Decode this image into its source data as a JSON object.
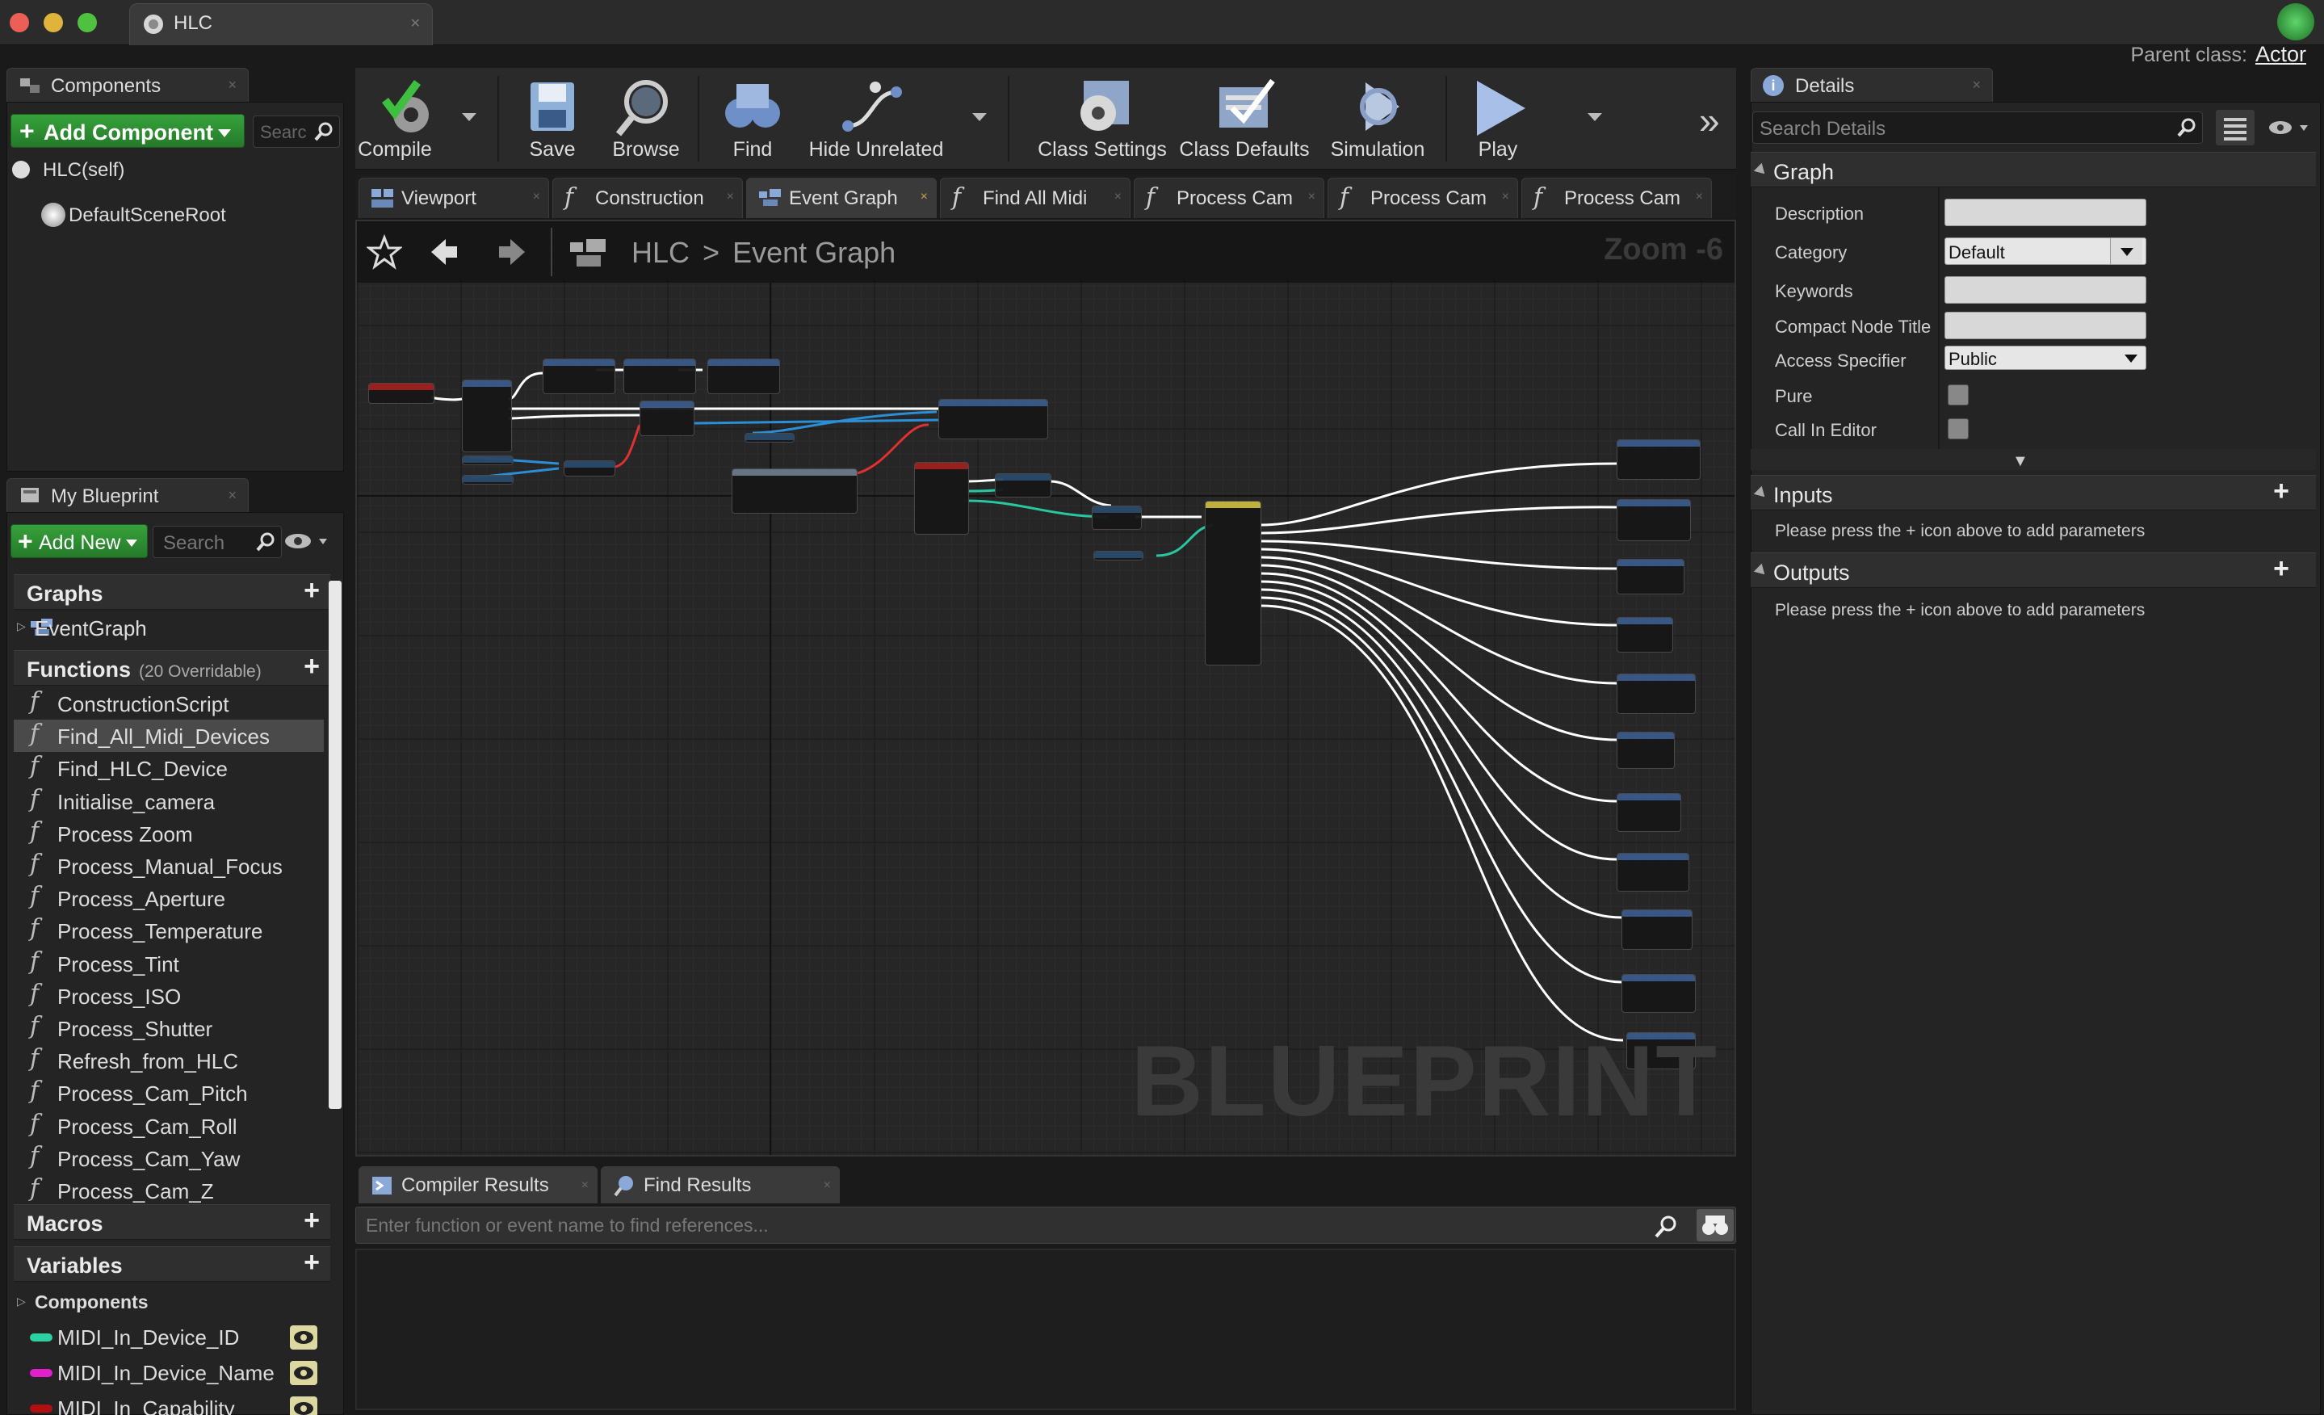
{
  "window": {
    "tab_title": "HLC",
    "parent_class_label": "Parent class:",
    "parent_class_value": "Actor"
  },
  "components_panel": {
    "tab_label": "Components",
    "add_component_label": "Add Component",
    "search_placeholder": "Searc",
    "tree": [
      {
        "label": "HLC(self)"
      },
      {
        "label": "DefaultSceneRoot"
      }
    ]
  },
  "toolbar": {
    "buttons": [
      {
        "label": "Compile",
        "icon": "compile-icon"
      },
      {
        "label": "Save",
        "icon": "save-icon"
      },
      {
        "label": "Browse",
        "icon": "browse-icon"
      },
      {
        "label": "Find",
        "icon": "find-icon"
      },
      {
        "label": "Hide Unrelated",
        "icon": "hide-unrelated-icon"
      },
      {
        "label": "Class Settings",
        "icon": "class-settings-icon"
      },
      {
        "label": "Class Defaults",
        "icon": "class-defaults-icon"
      },
      {
        "label": "Simulation",
        "icon": "simulation-icon"
      },
      {
        "label": "Play",
        "icon": "play-icon"
      }
    ]
  },
  "doc_tabs": [
    {
      "label": "Viewport",
      "icon": "viewport-icon"
    },
    {
      "label": "Construction",
      "icon": "function-icon"
    },
    {
      "label": "Event Graph",
      "icon": "event-graph-icon",
      "active": true
    },
    {
      "label": "Find All Midi",
      "icon": "function-icon"
    },
    {
      "label": "Process Cam",
      "icon": "function-icon"
    },
    {
      "label": "Process Cam",
      "icon": "function-icon"
    },
    {
      "label": "Process Cam",
      "icon": "function-icon"
    }
  ],
  "graph": {
    "breadcrumb_root": "HLC",
    "breadcrumb_sep": ">",
    "breadcrumb_current": "Event Graph",
    "zoom": "Zoom -6",
    "watermark": "BLUEPRINT"
  },
  "results": {
    "tabs": [
      {
        "label": "Compiler Results"
      },
      {
        "label": "Find Results"
      }
    ],
    "find_placeholder": "Enter function or event name to find references..."
  },
  "my_blueprint": {
    "tab_label": "My Blueprint",
    "add_new_label": "Add New",
    "search_placeholder": "Search",
    "graphs_label": "Graphs",
    "graphs": [
      {
        "label": "EventGraph"
      }
    ],
    "functions_label": "Functions",
    "functions_sub": "(20 Overridable)",
    "functions": [
      {
        "label": "ConstructionScript"
      },
      {
        "label": "Find_All_Midi_Devices",
        "selected": true
      },
      {
        "label": "Find_HLC_Device"
      },
      {
        "label": "Initialise_camera"
      },
      {
        "label": "Process Zoom"
      },
      {
        "label": "Process_Manual_Focus"
      },
      {
        "label": "Process_Aperture"
      },
      {
        "label": "Process_Temperature"
      },
      {
        "label": "Process_Tint"
      },
      {
        "label": "Process_ISO"
      },
      {
        "label": "Process_Shutter"
      },
      {
        "label": "Refresh_from_HLC"
      },
      {
        "label": "Process_Cam_Pitch"
      },
      {
        "label": "Process_Cam_Roll"
      },
      {
        "label": "Process_Cam_Yaw"
      },
      {
        "label": "Process_Cam_Z"
      }
    ],
    "macros_label": "Macros",
    "variables_label": "Variables",
    "variables_group": "Components",
    "variables": [
      {
        "label": "MIDI_In_Device_ID",
        "color": "#2bd1a0"
      },
      {
        "label": "MIDI_In_Device_Name",
        "color": "#e020c8"
      },
      {
        "label": "MIDI_In_Capability",
        "color": "#b01010"
      }
    ]
  },
  "details": {
    "tab_label": "Details",
    "search_placeholder": "Search Details",
    "graph_section": "Graph",
    "rows": {
      "description": "Description",
      "category": "Category",
      "category_value": "Default",
      "keywords": "Keywords",
      "compact_title": "Compact Node Title",
      "access": "Access Specifier",
      "access_value": "Public",
      "pure": "Pure",
      "call_in_editor": "Call In Editor"
    },
    "inputs_section": "Inputs",
    "inputs_hint": "Please press the + icon above to add parameters",
    "outputs_section": "Outputs",
    "outputs_hint": "Please press the + icon above to add parameters"
  },
  "colors": {
    "accent_green": "#2e8f33",
    "exec_wire": "#ffffff",
    "data_wire_teal": "#27c7a0",
    "data_wire_blue": "#2a8fd6",
    "data_wire_red": "#e03030"
  }
}
